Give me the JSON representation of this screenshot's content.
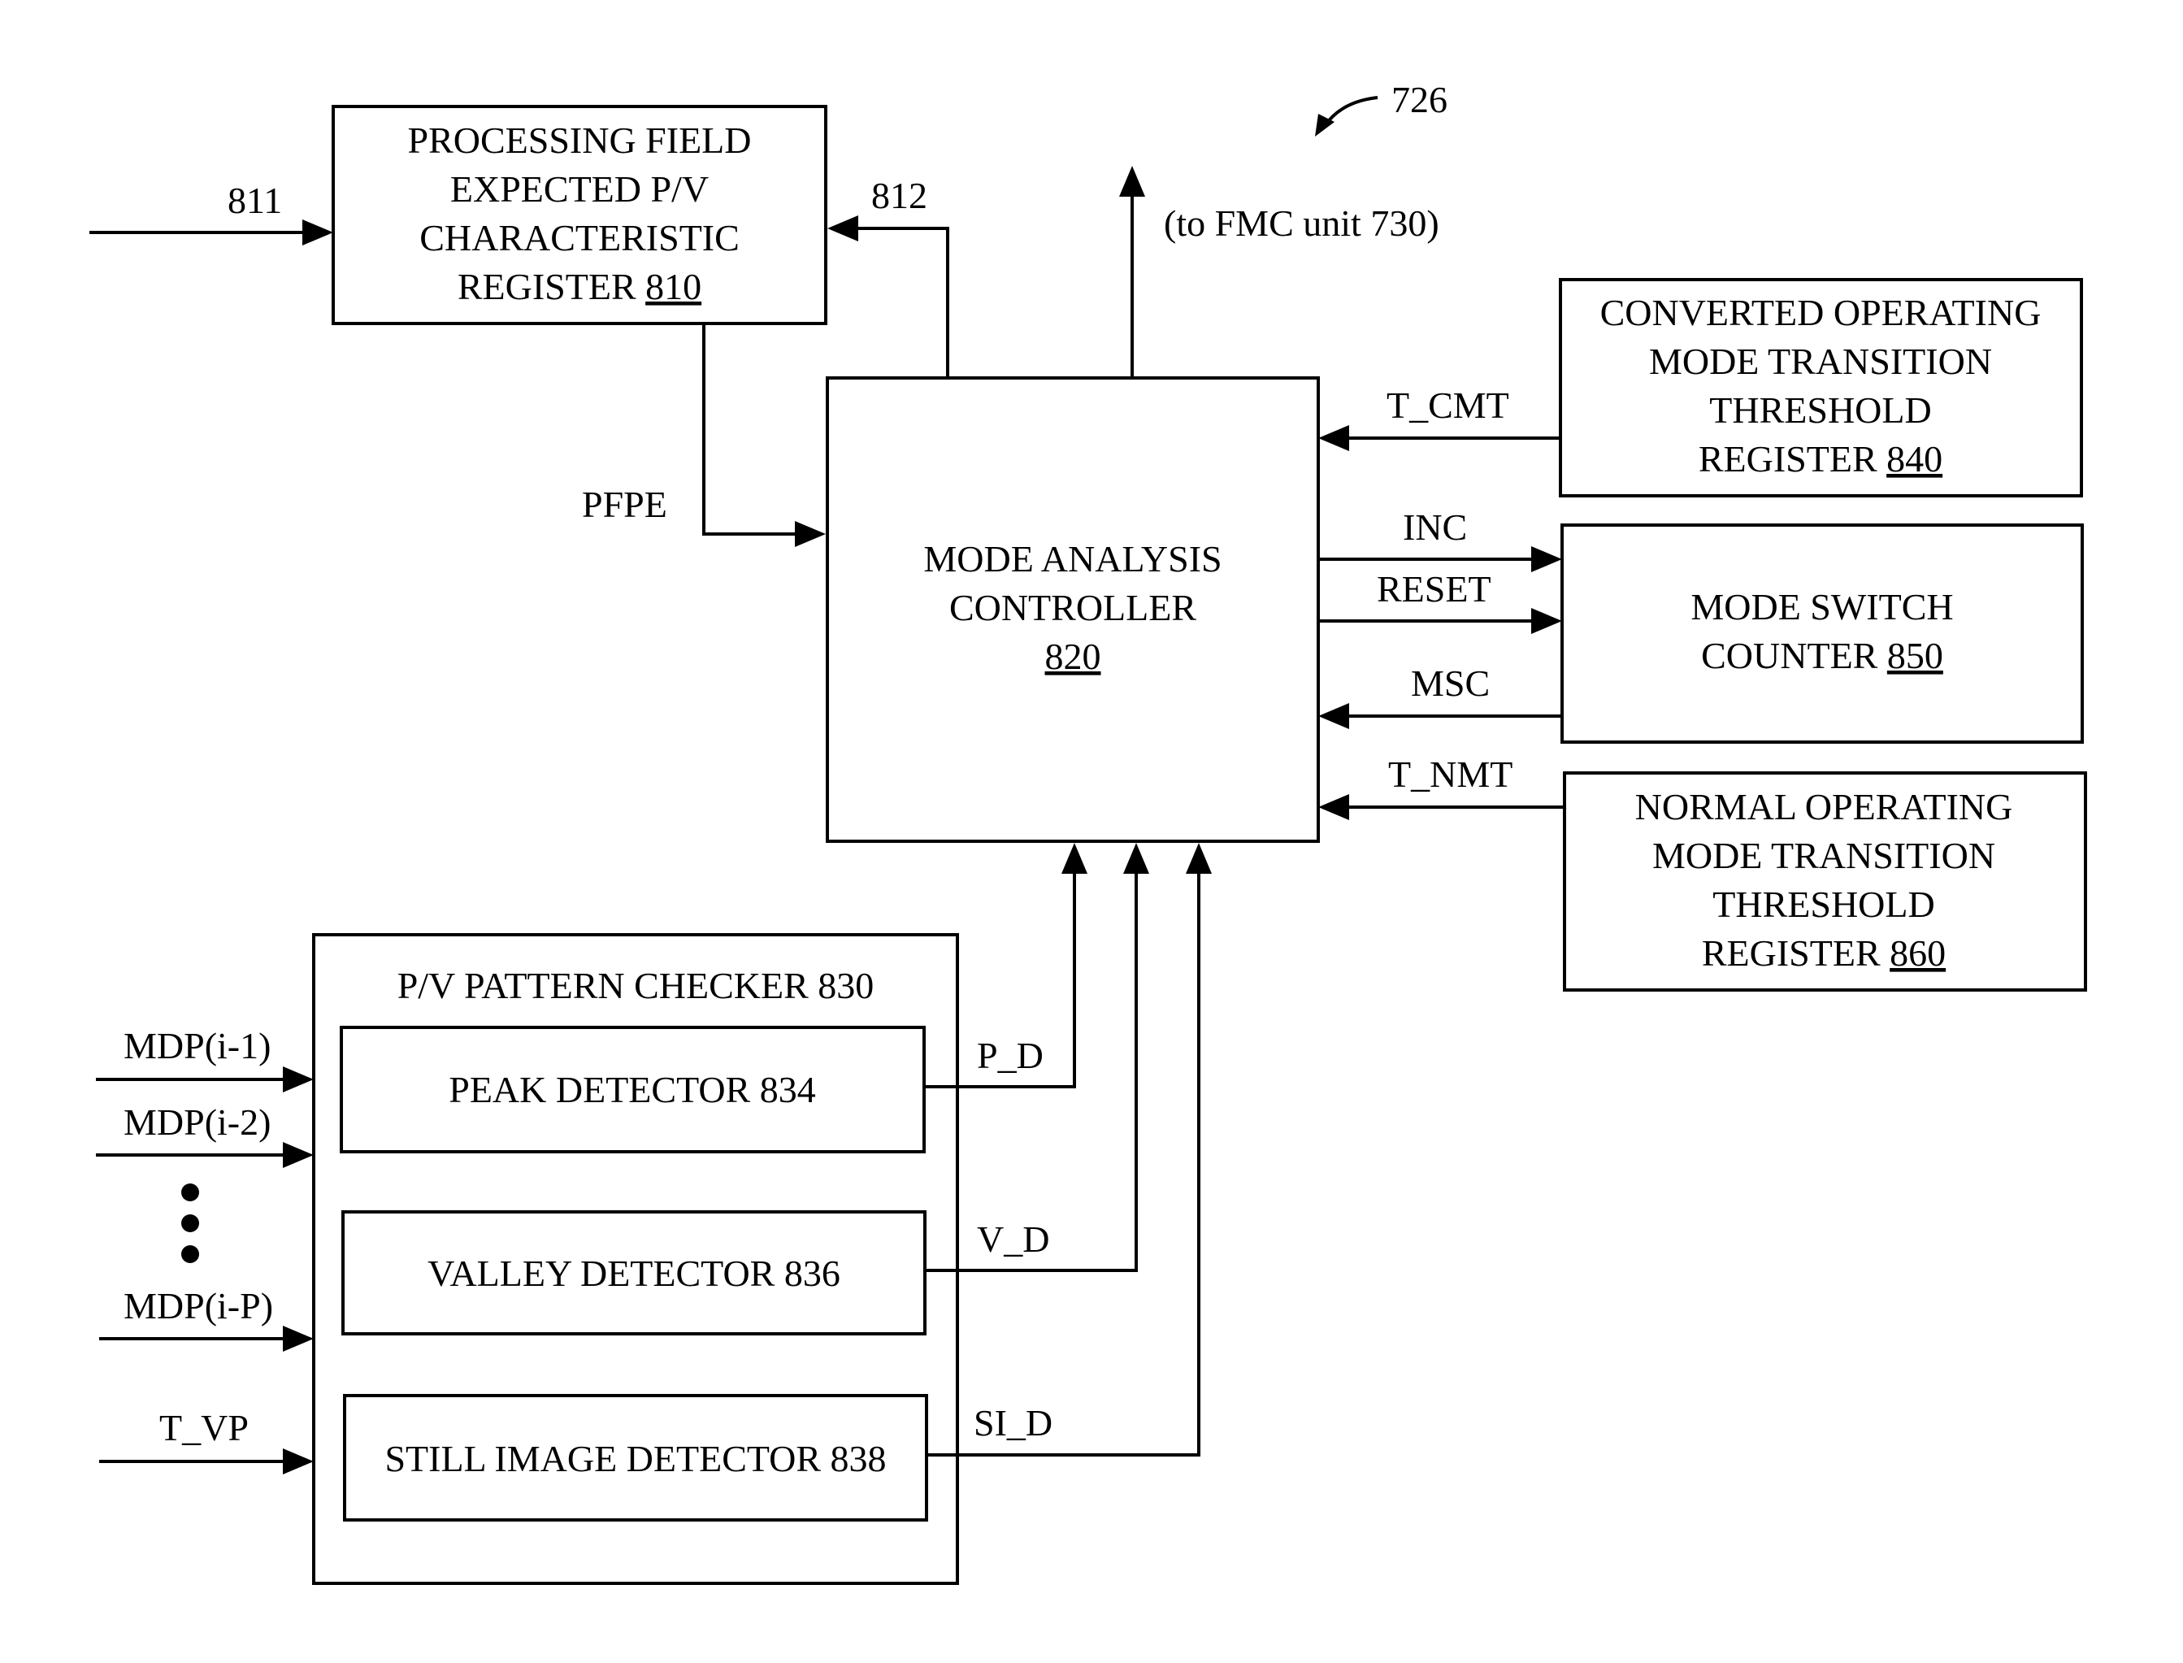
{
  "figure": {
    "reference_label": "726",
    "output_note": "(to FMC unit 730)"
  },
  "blocks": {
    "register_810": {
      "lines": [
        "PROCESSING FIELD",
        "EXPECTED P/V",
        "CHARACTERISTIC",
        "REGISTER "
      ],
      "ref": "810"
    },
    "controller_820": {
      "lines": [
        "MODE ANALYSIS",
        "CONTROLLER"
      ],
      "ref": "820"
    },
    "register_840": {
      "lines": [
        "CONVERTED OPERATING",
        "MODE TRANSITION",
        "THRESHOLD",
        "REGISTER "
      ],
      "ref": "840"
    },
    "counter_850": {
      "lines": [
        "MODE SWITCH",
        "COUNTER "
      ],
      "ref": "850"
    },
    "register_860": {
      "lines": [
        "NORMAL OPERATING",
        "MODE TRANSITION",
        "THRESHOLD",
        "REGISTER "
      ],
      "ref": "860"
    },
    "checker_830": {
      "title": "P/V PATTERN CHECKER 830"
    },
    "peak_834": {
      "label": "PEAK DETECTOR 834"
    },
    "valley_836": {
      "label": "VALLEY DETECTOR 836"
    },
    "still_838": {
      "label": "STILL IMAGE DETECTOR 838"
    }
  },
  "signals": {
    "s811": "811",
    "s812": "812",
    "pfpe": "PFPE",
    "t_cmt": "T_CMT",
    "inc": "INC",
    "reset": "RESET",
    "msc": "MSC",
    "t_nmt": "T_NMT",
    "p_d": "P_D",
    "v_d": "V_D",
    "si_d": "SI_D",
    "mdp1": "MDP(i-1)",
    "mdp2": "MDP(i-2)",
    "mdpp": "MDP(i-P)",
    "t_vp": "T_VP"
  }
}
